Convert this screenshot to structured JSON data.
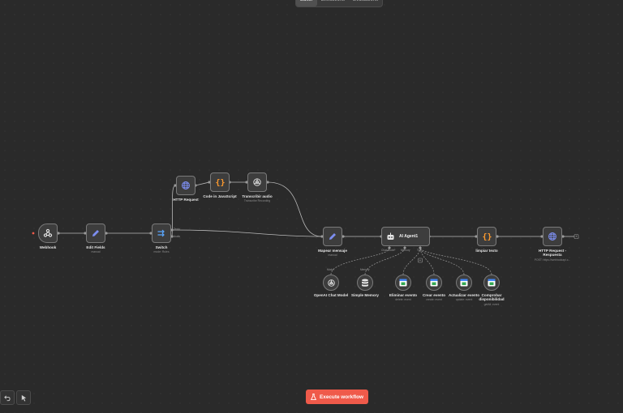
{
  "tabs": [
    "Editor",
    "Executions",
    "Evaluations"
  ],
  "nodes": {
    "webhook": {
      "label": "Webhook"
    },
    "edit_fields": {
      "label": "Edit Fields",
      "sub": "manual"
    },
    "switch": {
      "label": "Switch",
      "sub": "mode: Rules",
      "out1": "Texto",
      "out2": "Audio"
    },
    "http_request": {
      "label": "HTTP Request"
    },
    "code_js": {
      "label": "Code in JavaScript"
    },
    "transcribe": {
      "label": "Transcribir audio",
      "sub": "Transcribe Recording"
    },
    "mapear": {
      "label": "Mapear mensaje",
      "sub": "manual"
    },
    "agent": {
      "label": "AI Agent1",
      "port_chat": "Chat Model*",
      "port_memory": "Memory",
      "port_tool": "Tool"
    },
    "limpiar": {
      "label": "limpiar texto"
    },
    "http_response": {
      "label": "HTTP Request - Respuesta",
      "sub": "POST: https://webhookapi.c..."
    },
    "openai": {
      "label": "OpenAI Chat Model",
      "port": "Model"
    },
    "memory": {
      "label": "Simple Memory",
      "port": "Memory"
    },
    "eliminar": {
      "label": "Eliminar evento",
      "sub": "delete: event"
    },
    "crear": {
      "label": "Crear evento",
      "sub": "create: event"
    },
    "actualizar": {
      "label": "Actualizar evento",
      "sub": "update: event"
    },
    "comprobar": {
      "label": "Comprobar disponibilidad",
      "sub": "getAll: event"
    }
  },
  "execute_button": {
    "label": "Execute workflow"
  },
  "icons": {
    "webhook": "webhook-icon",
    "edit": "pencil-icon",
    "switch": "switch-icon",
    "http": "globe-icon",
    "code": "braces-icon",
    "openai": "openai-icon",
    "agent": "robot-icon",
    "memory": "database-icon",
    "calendar": "calendar-icon",
    "undo": "undo-icon",
    "cursor": "cursor-icon",
    "flask": "flask-icon"
  },
  "colors": {
    "canvas": "#2a2a2a",
    "node_bg": "#3d3d3d",
    "node_border": "#7a7a7a",
    "accent": "#ef5a4a",
    "pencil": "#7d8ef0",
    "code": "#ff9b2e"
  }
}
